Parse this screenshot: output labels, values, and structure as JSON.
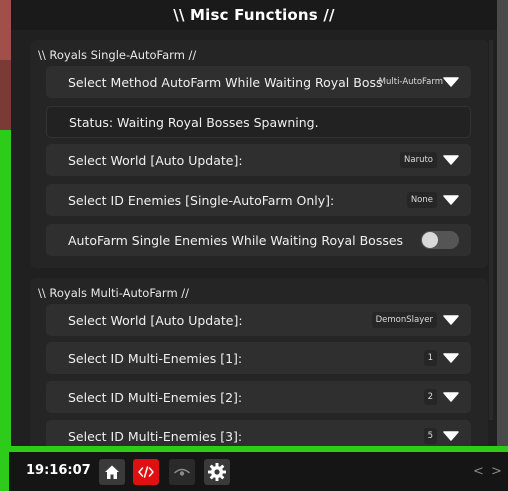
{
  "window": {
    "title": "\\\\ Misc Functions //"
  },
  "royals_single": {
    "title": "\\\\ Royals Single-AutoFarm //",
    "rows": [
      {
        "label": "Select Method AutoFarm While Waiting Royal Boss",
        "value": "Multi-AutoFarm"
      },
      {
        "label": "Status: Waiting Royal Bosses Spawning."
      },
      {
        "label": "Select World [Auto Update]:",
        "value": "Naruto"
      },
      {
        "label": "Select ID Enemies [Single-AutoFarm Only]:",
        "value": "None"
      },
      {
        "label": "AutoFarm Single Enemies While Waiting Royal Bosses"
      }
    ]
  },
  "royals_multi": {
    "title": "\\\\ Royals Multi-AutoFarm //",
    "rows": [
      {
        "label": "Select World [Auto Update]:",
        "value": "DemonSlayer"
      },
      {
        "label": "Select ID Multi-Enemies [1]:",
        "value": "1"
      },
      {
        "label": "Select ID Multi-Enemies [2]:",
        "value": "2"
      },
      {
        "label": "Select ID Multi-Enemies [3]:",
        "value": "5"
      }
    ]
  },
  "taskbar": {
    "time": "19:16:07",
    "prev": "<",
    "next": ">",
    "icons": [
      "home-icon",
      "code-icon",
      "eye-icon",
      "gear-icon"
    ]
  }
}
